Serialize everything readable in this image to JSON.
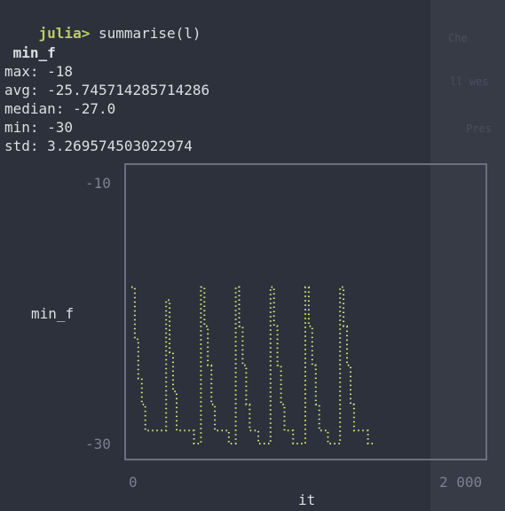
{
  "terminal": {
    "prompt": "julia>",
    "command": " summarise(l)",
    "heading": " min_f",
    "stats": [
      "max: -18",
      "avg: -25.745714285714286",
      "median: -27.0",
      "min: -30",
      "std: 3.269574503022974"
    ],
    "accent_color": "#bbcc66"
  },
  "chart_data": {
    "type": "line",
    "title": "",
    "xlabel": "it",
    "ylabel": "min_f",
    "xlim": [
      0,
      2000
    ],
    "ylim": [
      -30,
      -10
    ],
    "x_tick_labels": [
      "0",
      "2 000"
    ],
    "y_tick_labels": [
      "-10",
      "-30"
    ],
    "grid": false,
    "series": [
      {
        "color": "#dbe67a",
        "style": "dotted",
        "x": [
          0,
          20,
          40,
          60,
          80,
          100,
          200,
          220,
          240,
          260,
          280,
          300,
          330,
          360,
          400,
          420,
          440,
          460,
          480,
          500,
          530,
          560,
          600,
          620,
          640,
          660,
          680,
          700,
          730,
          760,
          800,
          820,
          840,
          860,
          880,
          900,
          930,
          960,
          1000,
          1020,
          1040,
          1060,
          1080,
          1100,
          1130,
          1160,
          1200,
          1220,
          1240,
          1260,
          1280,
          1300,
          1330,
          1360,
          1400
        ],
        "y": [
          -18,
          -22,
          -25,
          -27,
          -29,
          -29,
          -19,
          -23,
          -26,
          -29,
          -29,
          -29,
          -29,
          -30,
          -18,
          -21,
          -24,
          -27,
          -29,
          -29,
          -29,
          -30,
          -18,
          -21,
          -24,
          -27,
          -29,
          -29,
          -30,
          -30,
          -18,
          -21,
          -24,
          -27,
          -29,
          -29,
          -30,
          -30,
          -18,
          -21,
          -24,
          -27,
          -29,
          -29,
          -30,
          -30,
          -18,
          -21,
          -24,
          -27,
          -29,
          -29,
          -29,
          -30,
          -30
        ]
      }
    ]
  },
  "ghost_panel": {
    "lines": [
      "Che",
      "ll wes",
      "Pres"
    ]
  }
}
